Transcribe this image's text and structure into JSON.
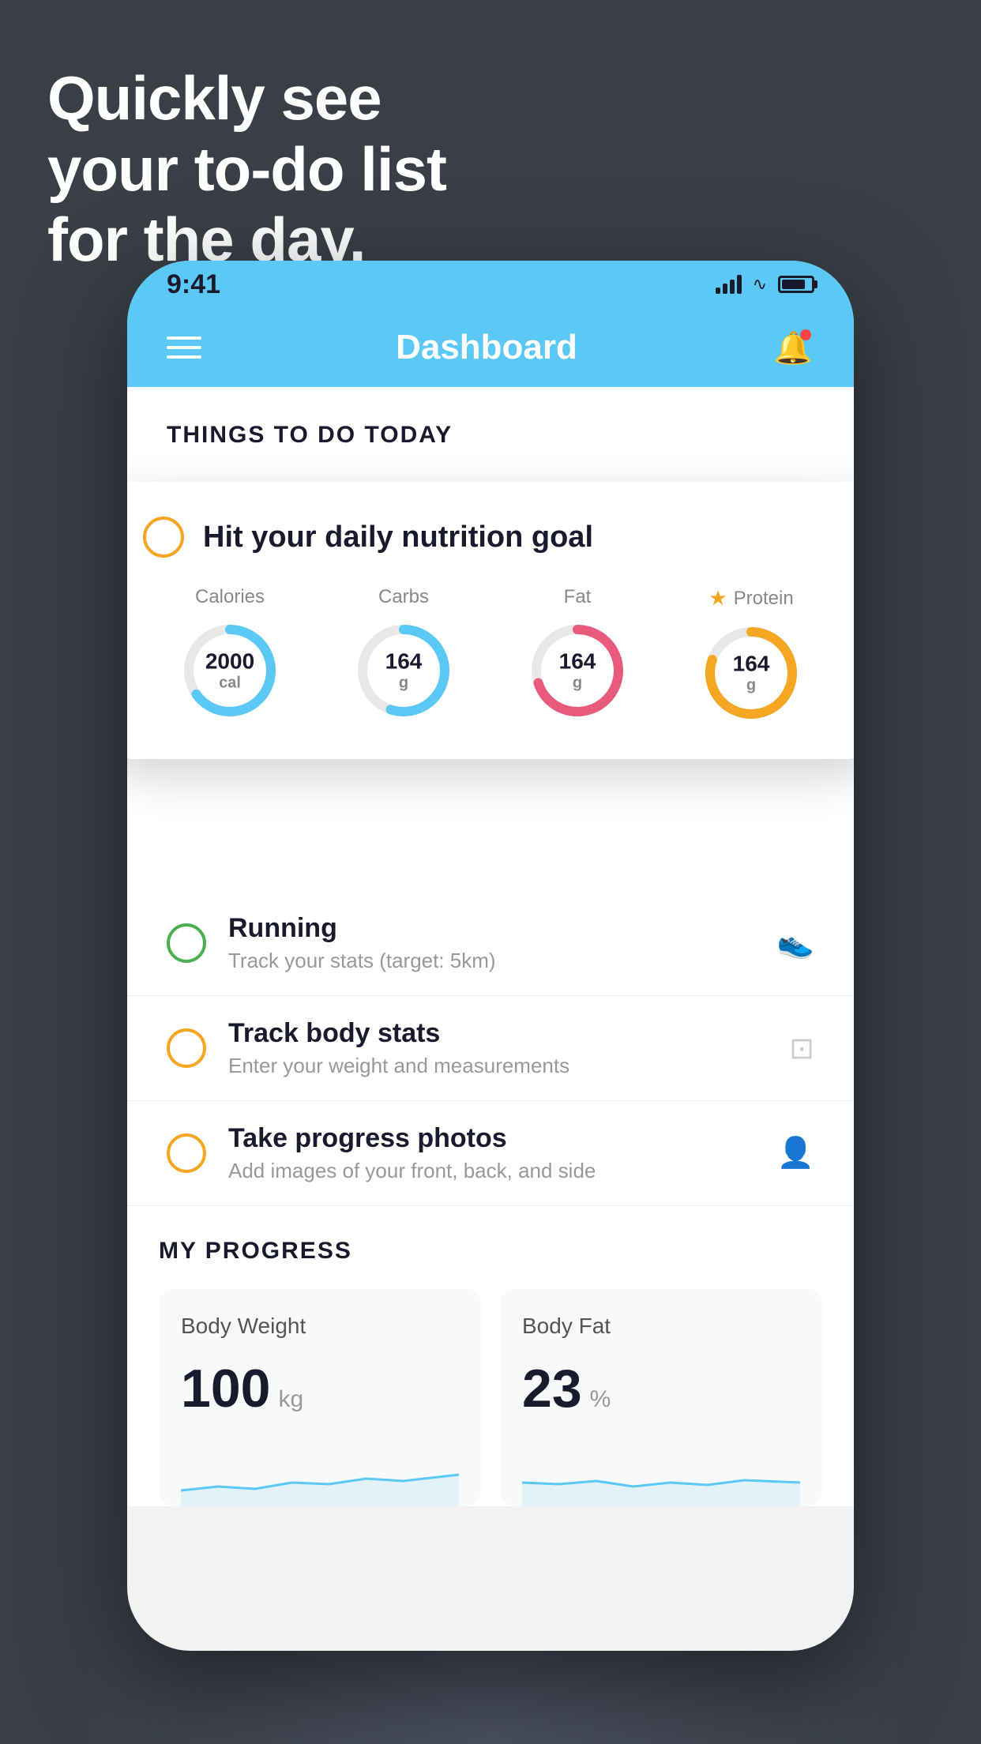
{
  "page": {
    "headline": "Quickly see\nyour to-do list\nfor the day.",
    "background_color": "#3a3f47"
  },
  "status_bar": {
    "time": "9:41",
    "signal_alt": "signal bars",
    "wifi_alt": "wifi",
    "battery_alt": "battery"
  },
  "app_header": {
    "title": "Dashboard",
    "menu_label": "menu",
    "notification_label": "notifications"
  },
  "things_to_do": {
    "section_title": "THINGS TO DO TODAY",
    "floating_card": {
      "title": "Hit your daily nutrition goal",
      "nutrients": [
        {
          "label": "Calories",
          "value": "2000",
          "unit": "cal",
          "color": "#5bc8f5",
          "track_color": "#e8e8e8",
          "pct": 65
        },
        {
          "label": "Carbs",
          "value": "164",
          "unit": "g",
          "color": "#5bc8f5",
          "track_color": "#e8e8e8",
          "pct": 55
        },
        {
          "label": "Fat",
          "value": "164",
          "unit": "g",
          "color": "#e95b7b",
          "track_color": "#e8e8e8",
          "pct": 70
        },
        {
          "label": "Protein",
          "value": "164",
          "unit": "g",
          "color": "#f5a623",
          "track_color": "#e8e8e8",
          "pct": 80,
          "starred": true
        }
      ]
    },
    "todo_items": [
      {
        "id": "running",
        "title": "Running",
        "subtitle": "Track your stats (target: 5km)",
        "circle_color": "green",
        "icon": "👟"
      },
      {
        "id": "body-stats",
        "title": "Track body stats",
        "subtitle": "Enter your weight and measurements",
        "circle_color": "yellow",
        "icon": "⚖️"
      },
      {
        "id": "progress-photos",
        "title": "Take progress photos",
        "subtitle": "Add images of your front, back, and side",
        "circle_color": "yellow2",
        "icon": "👤"
      }
    ]
  },
  "my_progress": {
    "section_title": "MY PROGRESS",
    "cards": [
      {
        "id": "body-weight",
        "title": "Body Weight",
        "value": "100",
        "unit": "kg",
        "chart_color": "#5bc8f5"
      },
      {
        "id": "body-fat",
        "title": "Body Fat",
        "value": "23",
        "unit": "%",
        "chart_color": "#5bc8f5"
      }
    ]
  }
}
